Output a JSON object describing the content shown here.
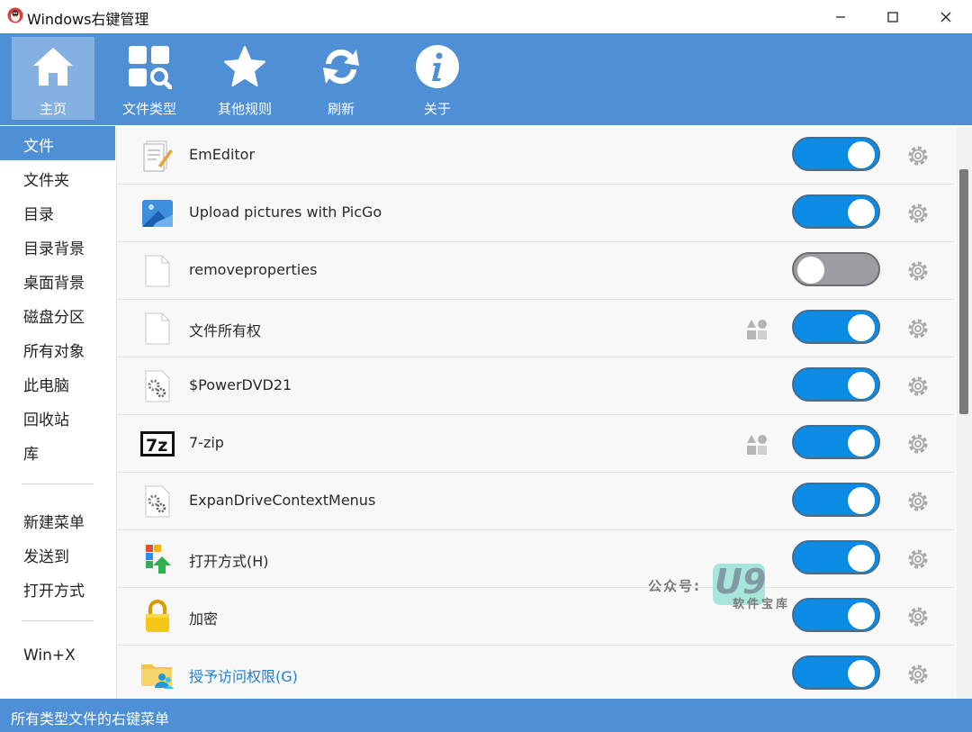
{
  "window": {
    "title": "Windows右键管理",
    "controls": [
      "minimize-icon",
      "maximize-icon",
      "close-icon"
    ]
  },
  "toolbar": {
    "items": [
      {
        "label": "主页",
        "icon": "home-icon",
        "active": true
      },
      {
        "label": "文件类型",
        "icon": "grid-search-icon",
        "active": false
      },
      {
        "label": "其他规则",
        "icon": "star-icon",
        "active": false
      },
      {
        "label": "刷新",
        "icon": "refresh-icon",
        "active": false
      },
      {
        "label": "关于",
        "icon": "info-icon",
        "active": false
      }
    ]
  },
  "sidebar": {
    "items": [
      {
        "label": "文件",
        "selected": true
      },
      {
        "label": "文件夹"
      },
      {
        "label": "目录"
      },
      {
        "label": "目录背景"
      },
      {
        "label": "桌面背景"
      },
      {
        "label": "磁盘分区"
      },
      {
        "label": "所有对象"
      },
      {
        "label": "此电脑"
      },
      {
        "label": "回收站"
      },
      {
        "label": "库"
      }
    ],
    "group2": [
      {
        "label": "新建菜单"
      },
      {
        "label": "发送到"
      },
      {
        "label": "打开方式"
      }
    ],
    "group3": [
      {
        "label": "Win+X"
      }
    ]
  },
  "rows": [
    {
      "name": "EmEditor",
      "icon": "emeditor-icon",
      "enabled": true,
      "ext": false
    },
    {
      "name": "Upload pictures with PicGo",
      "icon": "picgo-icon",
      "enabled": true,
      "ext": false
    },
    {
      "name": "removeproperties",
      "icon": "blank-file-icon",
      "enabled": false,
      "ext": false
    },
    {
      "name": "文件所有权",
      "icon": "blank-file-icon",
      "enabled": true,
      "ext": true
    },
    {
      "name": "$PowerDVD21",
      "icon": "settings-file-icon",
      "enabled": true,
      "ext": false
    },
    {
      "name": "7-zip",
      "icon": "7zip-icon",
      "enabled": true,
      "ext": true
    },
    {
      "name": "ExpanDriveContextMenus",
      "icon": "settings-file-icon",
      "enabled": true,
      "ext": false
    },
    {
      "name": "打开方式(H)",
      "icon": "open-with-icon",
      "enabled": true,
      "ext": false
    },
    {
      "name": "加密",
      "icon": "lock-icon",
      "enabled": true,
      "ext": false
    },
    {
      "name": "授予访问权限(G)",
      "icon": "share-folder-icon",
      "enabled": true,
      "ext": false,
      "link": true
    }
  ],
  "status": {
    "text": "所有类型文件的右键菜单"
  },
  "watermark": {
    "label": "公众号:",
    "logo": "U9",
    "sub": "软件宝库"
  },
  "colors": {
    "accent": "#4f8fd6",
    "toggle_on": "#0a8be5",
    "toggle_off": "#9a9ea3",
    "link": "#1c7ed6"
  }
}
